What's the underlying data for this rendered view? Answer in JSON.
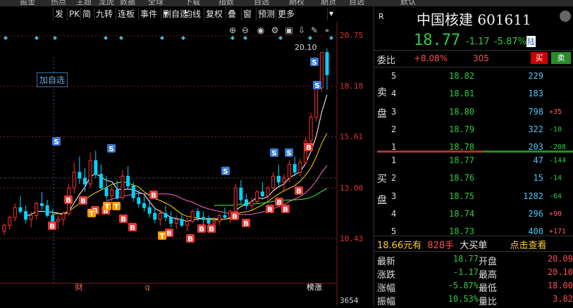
{
  "topbar": [
    "掘金",
    "热点",
    "主题",
    "龙虎",
    "数据",
    "全球",
    "下载",
    "指数",
    "自选",
    "期权",
    "期货",
    "自选",
    "默认"
  ],
  "toolbar": {
    "items": [
      "发",
      "PK",
      "简",
      "九转",
      "连板",
      "事件",
      "删自选",
      "均线",
      "复权",
      "叠",
      "窗",
      "预测",
      "更多"
    ]
  },
  "chart": {
    "y_axis_labels": [
      "20.75",
      "18.18",
      "15.61",
      "13.00",
      "10.43",
      "3654"
    ],
    "add_watchlist_label": "加自选",
    "high_label": "20.10",
    "bottom_markers": [
      "财",
      "q",
      "榜涨"
    ],
    "colors": {
      "up": "#ff3333",
      "down": "#00d4ff",
      "ma5": "#ffffff",
      "ma10": "#ffd700",
      "ma20": "#ff66cc",
      "ma60": "#33ff33"
    },
    "candles": [
      [
        10.8,
        11.2,
        10.6,
        11.1
      ],
      [
        11.1,
        11.6,
        10.9,
        11.5
      ],
      [
        11.5,
        12.2,
        11.3,
        12.0
      ],
      [
        12.0,
        12.6,
        11.7,
        11.8
      ],
      [
        11.8,
        12.1,
        11.2,
        11.4
      ],
      [
        11.4,
        11.8,
        11.0,
        11.6
      ],
      [
        11.6,
        12.3,
        11.4,
        12.2
      ],
      [
        12.2,
        12.8,
        11.9,
        12.1
      ],
      [
        12.1,
        12.4,
        11.5,
        11.6
      ],
      [
        11.6,
        11.9,
        11.2,
        11.3
      ],
      [
        11.3,
        11.6,
        10.9,
        11.4
      ],
      [
        11.4,
        11.8,
        11.1,
        11.7
      ],
      [
        11.7,
        13.2,
        11.6,
        13.0
      ],
      [
        13.0,
        14.3,
        12.7,
        13.8
      ],
      [
        13.8,
        14.6,
        13.2,
        13.5
      ],
      [
        13.5,
        14.0,
        12.8,
        13.2
      ],
      [
        13.2,
        14.8,
        13.0,
        14.4
      ],
      [
        14.4,
        14.9,
        13.5,
        13.7
      ],
      [
        13.7,
        14.2,
        12.9,
        13.0
      ],
      [
        13.0,
        13.6,
        12.4,
        12.6
      ],
      [
        12.6,
        13.1,
        12.2,
        12.9
      ],
      [
        12.9,
        13.4,
        12.4,
        12.5
      ],
      [
        12.5,
        13.9,
        12.4,
        13.6
      ],
      [
        13.6,
        14.1,
        12.9,
        13.1
      ],
      [
        13.1,
        13.3,
        12.3,
        12.5
      ],
      [
        12.5,
        12.9,
        12.0,
        12.2
      ],
      [
        12.2,
        12.6,
        11.8,
        12.0
      ],
      [
        12.0,
        12.4,
        11.5,
        11.7
      ],
      [
        11.7,
        12.0,
        11.2,
        11.4
      ],
      [
        11.4,
        11.9,
        11.1,
        11.7
      ],
      [
        11.7,
        12.1,
        11.3,
        11.5
      ],
      [
        11.5,
        11.8,
        11.0,
        11.2
      ],
      [
        11.2,
        11.6,
        10.9,
        11.4
      ],
      [
        11.4,
        11.7,
        11.0,
        11.1
      ],
      [
        11.1,
        11.5,
        10.8,
        11.3
      ],
      [
        11.3,
        11.9,
        11.2,
        11.8
      ],
      [
        11.8,
        12.0,
        11.3,
        11.5
      ],
      [
        11.5,
        11.8,
        11.1,
        11.4
      ],
      [
        11.4,
        11.6,
        11.0,
        11.2
      ],
      [
        11.2,
        11.5,
        10.9,
        11.3
      ],
      [
        11.3,
        11.7,
        11.1,
        11.6
      ],
      [
        11.6,
        12.0,
        11.4,
        11.5
      ],
      [
        11.5,
        11.9,
        11.2,
        11.8
      ],
      [
        11.8,
        13.2,
        11.7,
        13.0
      ],
      [
        13.0,
        13.4,
        12.2,
        12.4
      ],
      [
        12.4,
        12.7,
        11.9,
        12.1
      ],
      [
        12.1,
        12.5,
        11.9,
        12.3
      ],
      [
        12.3,
        12.9,
        12.2,
        12.8
      ],
      [
        12.8,
        13.3,
        12.5,
        12.6
      ],
      [
        12.6,
        13.1,
        12.4,
        13.0
      ],
      [
        13.0,
        13.8,
        12.9,
        13.6
      ],
      [
        13.6,
        14.2,
        13.1,
        13.3
      ],
      [
        13.3,
        13.7,
        12.8,
        13.5
      ],
      [
        13.5,
        14.4,
        13.3,
        14.2
      ],
      [
        14.2,
        14.6,
        13.6,
        13.8
      ],
      [
        13.8,
        14.5,
        13.6,
        14.3
      ],
      [
        14.3,
        15.6,
        14.2,
        15.4
      ],
      [
        15.4,
        16.8,
        15.2,
        16.6
      ],
      [
        16.6,
        18.3,
        16.4,
        18.1
      ],
      [
        18.1,
        19.9,
        17.9,
        19.9
      ],
      [
        19.9,
        20.1,
        18.0,
        18.77
      ]
    ]
  },
  "right": {
    "tag": "R",
    "title": "中国核建 601611",
    "price": "18.77",
    "change": "-1.17",
    "change_pct": "-5.87%",
    "board_tag": "陆",
    "weibi_label": "委比",
    "weibi_value": "+8.08%",
    "weicha_value": "305",
    "buy_label": "买",
    "sell_label": "卖",
    "sell_side_label": [
      "卖",
      "盘"
    ],
    "buy_side_label": [
      "买",
      "盘"
    ],
    "asks": [
      {
        "level": "5",
        "price": "18.82",
        "vol": "229",
        "delta": ""
      },
      {
        "level": "4",
        "price": "18.81",
        "vol": "183",
        "delta": ""
      },
      {
        "level": "3",
        "price": "18.80",
        "vol": "798",
        "delta": "+35"
      },
      {
        "level": "2",
        "price": "18.79",
        "vol": "322",
        "delta": "-10"
      },
      {
        "level": "1",
        "price": "18.78",
        "vol": "203",
        "delta": "-208"
      }
    ],
    "bids": [
      {
        "level": "1",
        "price": "18.77",
        "vol": "47",
        "delta": "-144"
      },
      {
        "level": "2",
        "price": "18.76",
        "vol": "15",
        "delta": "-14"
      },
      {
        "level": "3",
        "price": "18.75",
        "vol": "1282",
        "delta": "-64"
      },
      {
        "level": "4",
        "price": "18.74",
        "vol": "296",
        "delta": "+90"
      },
      {
        "level": "5",
        "price": "18.73",
        "vol": "400",
        "delta": "+171"
      }
    ],
    "big_order": {
      "price": "18.66元有",
      "qty": "828手",
      "label": "大买单",
      "link": "点击查看"
    },
    "stats": [
      {
        "l1": "最新",
        "v1": "18.77",
        "l2": "开盘",
        "v2": "20.09"
      },
      {
        "l1": "涨跌",
        "v1": "-1.17",
        "l2": "最高",
        "v2": "20.10"
      },
      {
        "l1": "涨幅",
        "v1": "-5.87%",
        "l2": "最低",
        "v2": "18.00"
      },
      {
        "l1": "振幅",
        "v1": "10.53%",
        "l2": "量比",
        "v2": "3.82"
      }
    ]
  }
}
